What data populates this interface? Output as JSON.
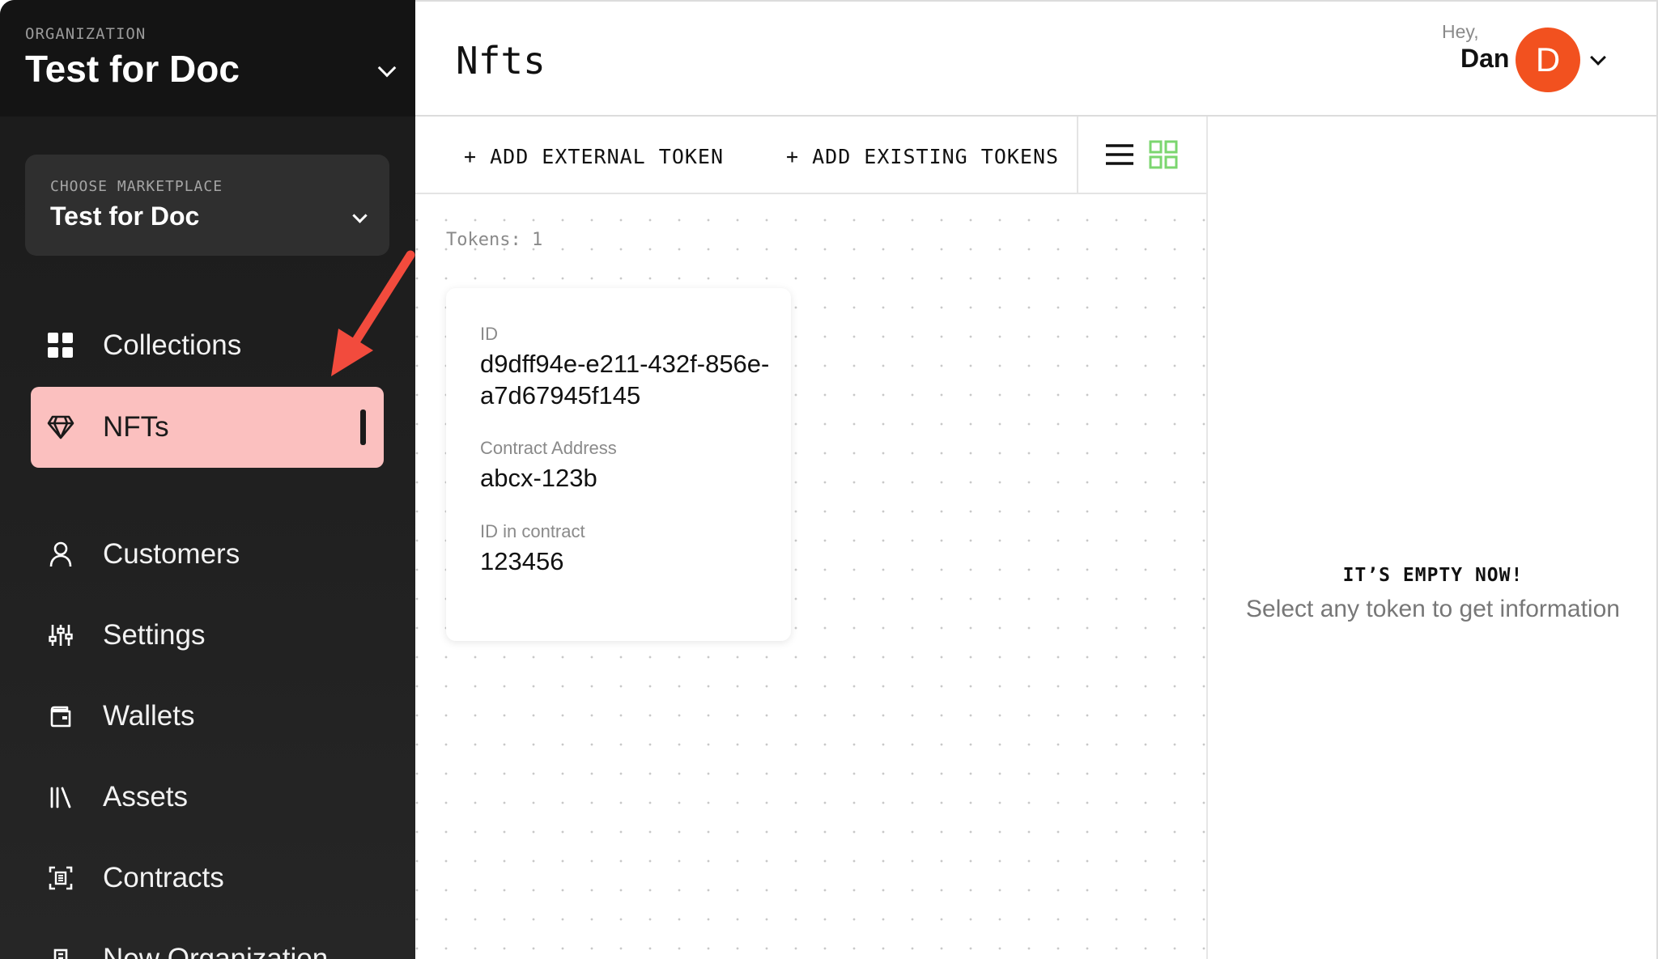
{
  "organization": {
    "label": "ORGANIZATION",
    "name": "Test for Doc"
  },
  "marketplace": {
    "label": "CHOOSE MARKETPLACE",
    "name": "Test for Doc"
  },
  "nav": {
    "items": [
      {
        "label": "Collections",
        "icon": "grid-icon"
      },
      {
        "label": "NFTs",
        "icon": "diamond-icon",
        "active": true
      },
      {
        "label": "Customers",
        "icon": "user-icon"
      },
      {
        "label": "Settings",
        "icon": "sliders-icon"
      },
      {
        "label": "Wallets",
        "icon": "wallet-icon"
      },
      {
        "label": "Assets",
        "icon": "library-icon"
      },
      {
        "label": "Contracts",
        "icon": "contract-icon"
      },
      {
        "label": "New Organization",
        "icon": "building-icon"
      }
    ]
  },
  "header": {
    "title": "Nfts",
    "greeting": "Hey,",
    "user_name": "Dan",
    "avatar_initial": "D"
  },
  "toolbar": {
    "add_external": "+ ADD EXTERNAL TOKEN",
    "add_existing": "+ ADD EXISTING TOKENS"
  },
  "tokens": {
    "count_label": "Tokens: 1",
    "items": [
      {
        "id_label": "ID",
        "id": "d9dff94e-e211-432f-856e-a7d67945f145",
        "contract_label": "Contract Address",
        "contract": "abcx-123b",
        "id_in_contract_label": "ID in contract",
        "id_in_contract": "123456"
      }
    ]
  },
  "details": {
    "empty_title": "IT’S EMPTY NOW!",
    "empty_subtitle": "Select any token to get information"
  },
  "colors": {
    "accent": "#fbc0bf",
    "avatar": "#f2511f",
    "grid_active": "#7bd66f",
    "annotation": "#f24b3d"
  }
}
